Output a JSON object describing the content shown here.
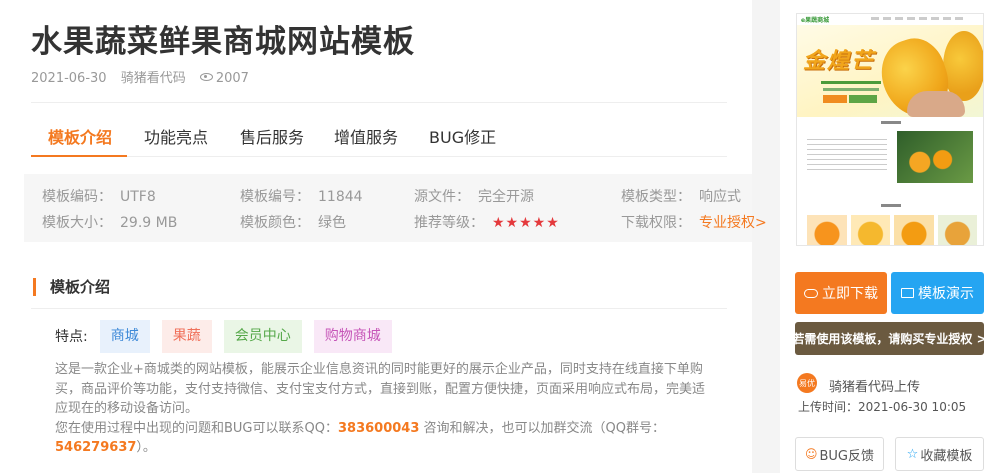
{
  "page": {
    "title": "水果蔬菜鲜果商城网站模板",
    "date": "2021-06-30",
    "author": "骑猪看代码",
    "views": "2007"
  },
  "tabs": [
    {
      "label": "模板介绍",
      "active": true
    },
    {
      "label": "功能亮点",
      "active": false
    },
    {
      "label": "售后服务",
      "active": false
    },
    {
      "label": "增值服务",
      "active": false
    },
    {
      "label": "BUG修正",
      "active": false
    }
  ],
  "info": {
    "encoding": {
      "label": "模板编码：",
      "value": "UTF8"
    },
    "number": {
      "label": "模板编号：",
      "value": "11844"
    },
    "source": {
      "label": "源文件：",
      "value": "完全开源"
    },
    "type": {
      "label": "模板类型：",
      "value": "响应式"
    },
    "size": {
      "label": "模板大小：",
      "value": "29.9 MB"
    },
    "color": {
      "label": "模板颜色：",
      "value": "绿色"
    },
    "rating": {
      "label": "推荐等级：",
      "value": "★★★★★"
    },
    "permission": {
      "label": "下载权限：",
      "value": "专业授权>"
    }
  },
  "section": {
    "title": "模板介绍",
    "features_label": "特点:",
    "tags": [
      "商城",
      "果蔬",
      "会员中心",
      "购物商城"
    ],
    "desc1": "这是一款企业+商城类的网站模板，能展示企业信息资讯的同时能更好的展示企业产品，同时支持在线直接下单购买，商品评价等功能，支付支持微信、支付宝支付方式，直接到账，配置方便快捷，页面采用响应式布局，完美适应现在的移动设备访问。",
    "desc2_pre": "您在使用过程中出现的问题和BUG可以联系QQ：",
    "qq": "383600043",
    "desc2_mid": " 咨询和解决，也可以加群交流（QQ群号：",
    "qq_group": "546279637",
    "desc2_end": "）。"
  },
  "sidebar": {
    "preview": {
      "logo": "e果蔬商城",
      "banner_title": "金煌芒"
    },
    "download_label": "立即下载",
    "demo_label": "模板演示",
    "license_label": "若需使用该模板，请购买专业授权 >",
    "uploader_avatar": "易优",
    "uploader_name": "骑猪看代码上传",
    "upload_time": "上传时间：2021-06-30 10:05",
    "bug_label": "BUG反馈",
    "fav_label": "收藏模板"
  },
  "colors": {
    "accent": "#f47920",
    "demo_blue": "#25a5f2",
    "license_brown": "#6b5a40",
    "star_red": "#e4393c"
  }
}
